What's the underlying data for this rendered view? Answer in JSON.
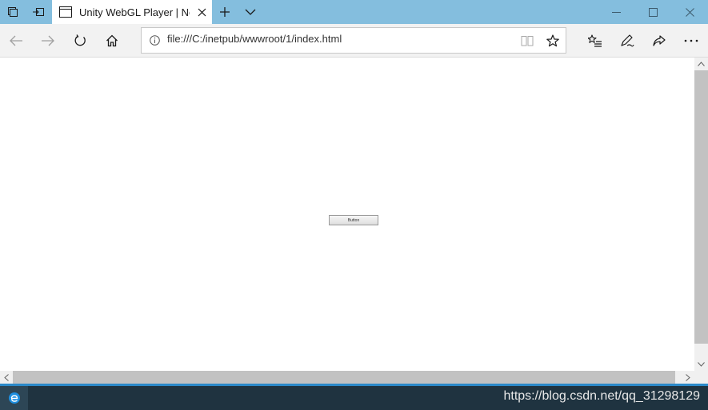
{
  "browser": {
    "tab": {
      "title": "Unity WebGL Player | Ne",
      "icon": "page-icon"
    },
    "address_bar": {
      "url": "file:///C:/inetpub/wwwroot/1/index.html"
    },
    "icons": {
      "tab_manager": "set-aside-tabs-icon",
      "tabs_aside": "show-aside-tabs-icon",
      "new_tab": "plus-icon",
      "tab_list": "chevron-down-icon",
      "minimize": "minimize-icon",
      "maximize": "maximize-icon",
      "close": "close-icon",
      "back": "arrow-left-icon",
      "forward": "arrow-right-icon",
      "refresh": "refresh-icon",
      "home": "home-icon",
      "info": "info-icon",
      "reading_view": "book-icon",
      "favorite": "star-icon",
      "favorites_hub": "favorites-list-icon",
      "notes": "pen-icon",
      "share": "share-icon",
      "more": "more-dots-icon"
    }
  },
  "page": {
    "unity_button_label": "Button"
  },
  "taskbar": {
    "watermark": "https://blog.csdn.net/qq_31298129"
  },
  "colors": {
    "titlebar": "#84bede",
    "toolbar": "#f2f2f2",
    "taskbar": "#1f3340",
    "taskbar_accent": "#2b89c9"
  }
}
